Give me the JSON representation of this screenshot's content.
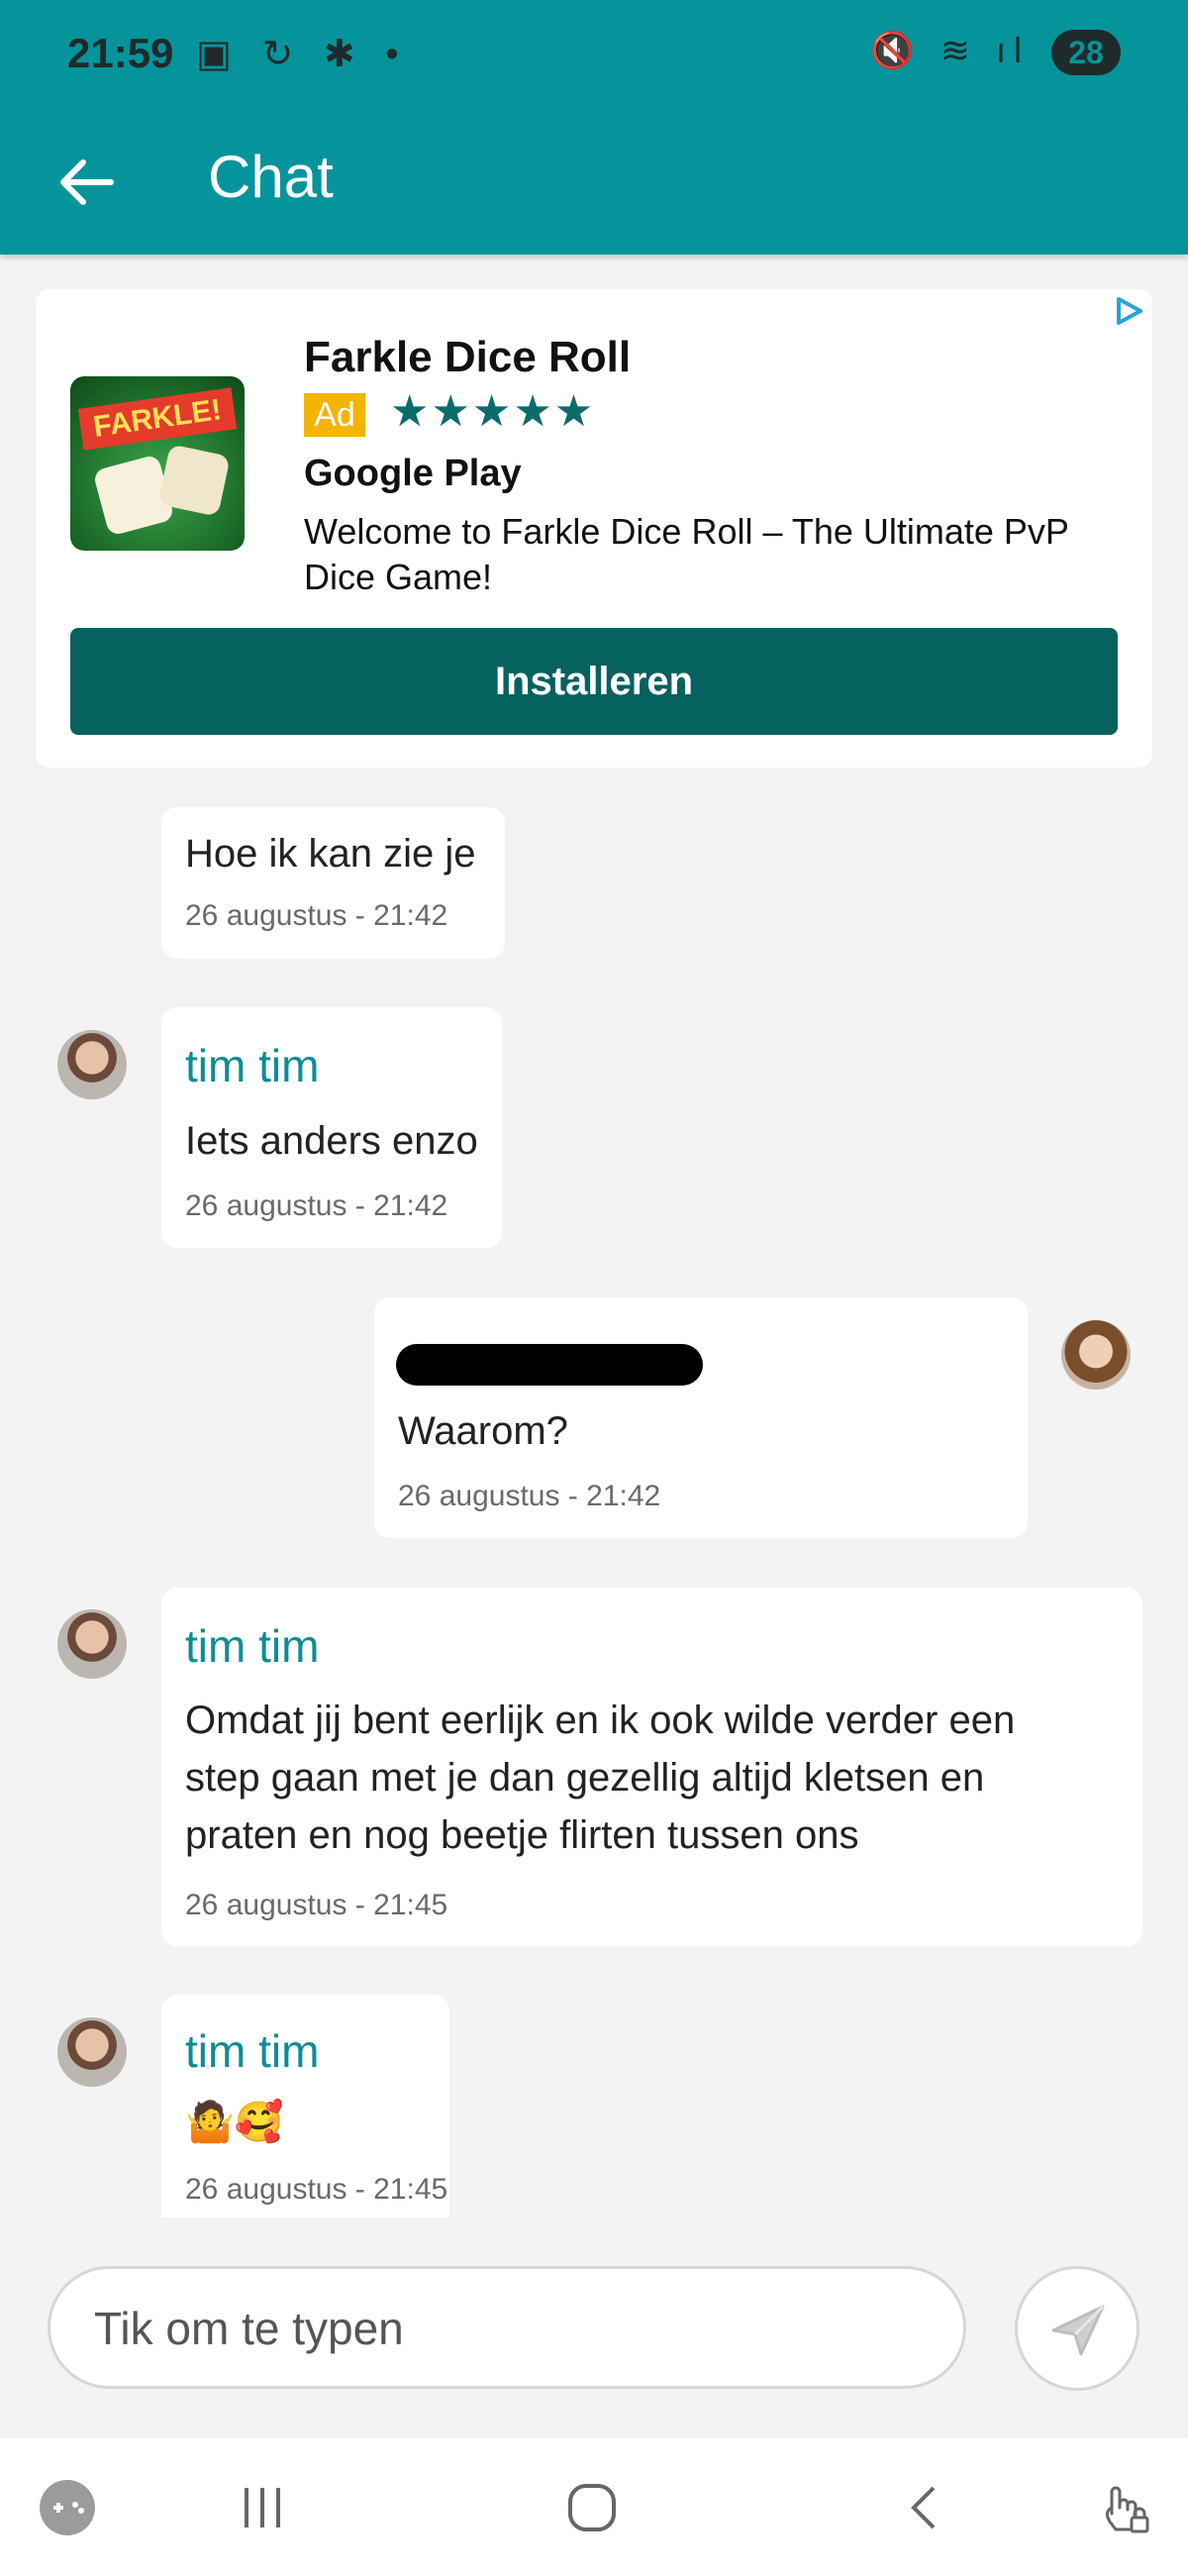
{
  "status": {
    "time": "21:59",
    "left_icons": "▣ ↻ ✱ •",
    "right_icons": "🔇 ≋ ıl",
    "battery": "28"
  },
  "header": {
    "title": "Chat"
  },
  "ad": {
    "title": "Farkle Dice Roll",
    "badge": "Ad",
    "stars": "★★★★★",
    "store": "Google Play",
    "description": "Welcome to Farkle Dice Roll – The Ultimate PvP Dice Game!",
    "logo_text": "FARKLE!",
    "install_label": "Installeren"
  },
  "messages": [
    {
      "text": "Hoe ik kan zie je",
      "time": "26 augustus - 21:42"
    },
    {
      "name": "tim tim",
      "text": "Iets anders enzo",
      "time": "26 augustus - 21:42"
    },
    {
      "text": "Waarom?",
      "time": "26 augustus - 21:42"
    },
    {
      "name": "tim tim",
      "text": "Omdat jij bent eerlijk en ik ook wilde verder een step gaan met je dan gezellig altijd kletsen en praten en nog beetje flirten tussen ons",
      "time": "26 augustus - 21:45"
    },
    {
      "name": "tim tim",
      "text": "🤷🥰",
      "time": "26 augustus - 21:45"
    }
  ],
  "input": {
    "placeholder": "Tik om te typen"
  },
  "colors": {
    "primary": "#05949b",
    "install": "#06625f",
    "name": "#0c8d93"
  }
}
